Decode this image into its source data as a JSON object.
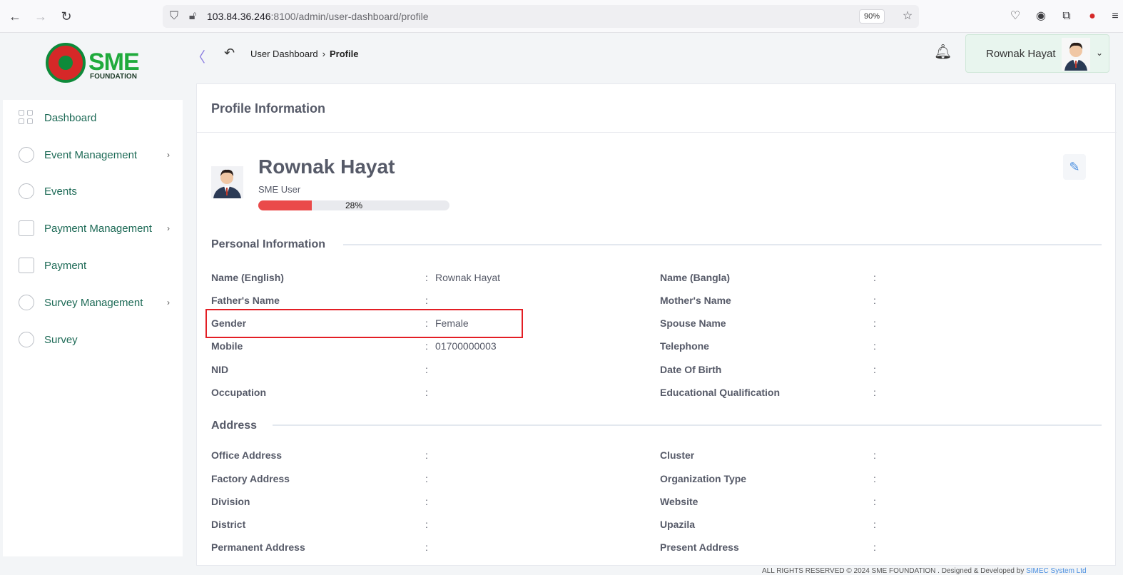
{
  "browser": {
    "url_host": "103.84.36.246",
    "url_path": ":8100/admin/user-dashboard/profile",
    "zoom": "90%"
  },
  "header": {
    "logo_text": "SME",
    "logo_sub": "FOUNDATION",
    "breadcrumb_parent": "User Dashboard",
    "breadcrumb_current": "Profile",
    "user_name": "Rownak Hayat"
  },
  "sidebar": {
    "items": [
      {
        "label": "Dashboard",
        "icon": "grid-icon",
        "has_submenu": false
      },
      {
        "label": "Event Management",
        "icon": "lock-icon",
        "has_submenu": true
      },
      {
        "label": "Events",
        "icon": "lock-icon",
        "has_submenu": false
      },
      {
        "label": "Payment Management",
        "icon": "money-icon",
        "has_submenu": true
      },
      {
        "label": "Payment",
        "icon": "money-icon",
        "has_submenu": false
      },
      {
        "label": "Survey Management",
        "icon": "pie-icon",
        "has_submenu": true
      },
      {
        "label": "Survey",
        "icon": "pie-icon",
        "has_submenu": false
      }
    ]
  },
  "main": {
    "card_title": "Profile Information",
    "profile": {
      "name": "Rownak Hayat",
      "role": "SME User",
      "completion_percent": 28,
      "completion_label": "28%"
    },
    "personal_title": "Personal Information",
    "personal_left": [
      {
        "label": "Name (English)",
        "value": "Rownak Hayat"
      },
      {
        "label": "Father's Name",
        "value": ""
      },
      {
        "label": "Gender",
        "value": "Female"
      },
      {
        "label": "Mobile",
        "value": "01700000003"
      },
      {
        "label": "NID",
        "value": ""
      },
      {
        "label": "Occupation",
        "value": ""
      }
    ],
    "personal_right": [
      {
        "label": "Name (Bangla)",
        "value": ""
      },
      {
        "label": "Mother's Name",
        "value": ""
      },
      {
        "label": "Spouse Name",
        "value": ""
      },
      {
        "label": "Telephone",
        "value": ""
      },
      {
        "label": "Date Of Birth",
        "value": ""
      },
      {
        "label": "Educational Qualification",
        "value": ""
      }
    ],
    "address_title": "Address",
    "address_left": [
      {
        "label": "Office Address",
        "value": ""
      },
      {
        "label": "Factory Address",
        "value": ""
      },
      {
        "label": "Division",
        "value": ""
      },
      {
        "label": "District",
        "value": ""
      },
      {
        "label": "Permanent Address",
        "value": ""
      }
    ],
    "address_right": [
      {
        "label": "Cluster",
        "value": ""
      },
      {
        "label": "Organization Type",
        "value": ""
      },
      {
        "label": "Website",
        "value": ""
      },
      {
        "label": "Upazila",
        "value": ""
      },
      {
        "label": "Present Address",
        "value": ""
      }
    ]
  },
  "footer": {
    "text": "ALL RIGHTS RESERVED © 2024 SME FOUNDATION . Designed & Developed by ",
    "link": "SIMEC System Ltd"
  },
  "colors": {
    "accent_green": "#1d6a56",
    "progress_red": "#ea4a4a",
    "highlight_red": "#e31e24"
  }
}
